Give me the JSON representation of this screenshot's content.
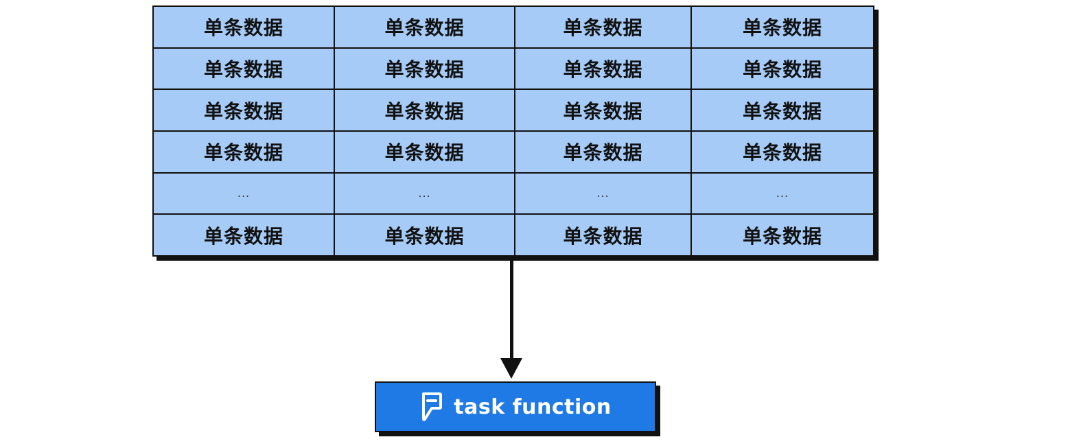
{
  "grid": {
    "rows": [
      [
        "单条数据",
        "单条数据",
        "单条数据",
        "单条数据"
      ],
      [
        "单条数据",
        "单条数据",
        "单条数据",
        "单条数据"
      ],
      [
        "单条数据",
        "单条数据",
        "单条数据",
        "单条数据"
      ],
      [
        "单条数据",
        "单条数据",
        "单条数据",
        "单条数据"
      ],
      [
        "...",
        "...",
        "...",
        "..."
      ],
      [
        "单条数据",
        "单条数据",
        "单条数据",
        "单条数据"
      ]
    ]
  },
  "task": {
    "label": "task function",
    "icon": "foursquare-icon",
    "color": "#1f7ae6"
  },
  "colors": {
    "cell_fill": "#a6cbf7",
    "border": "#111111"
  }
}
